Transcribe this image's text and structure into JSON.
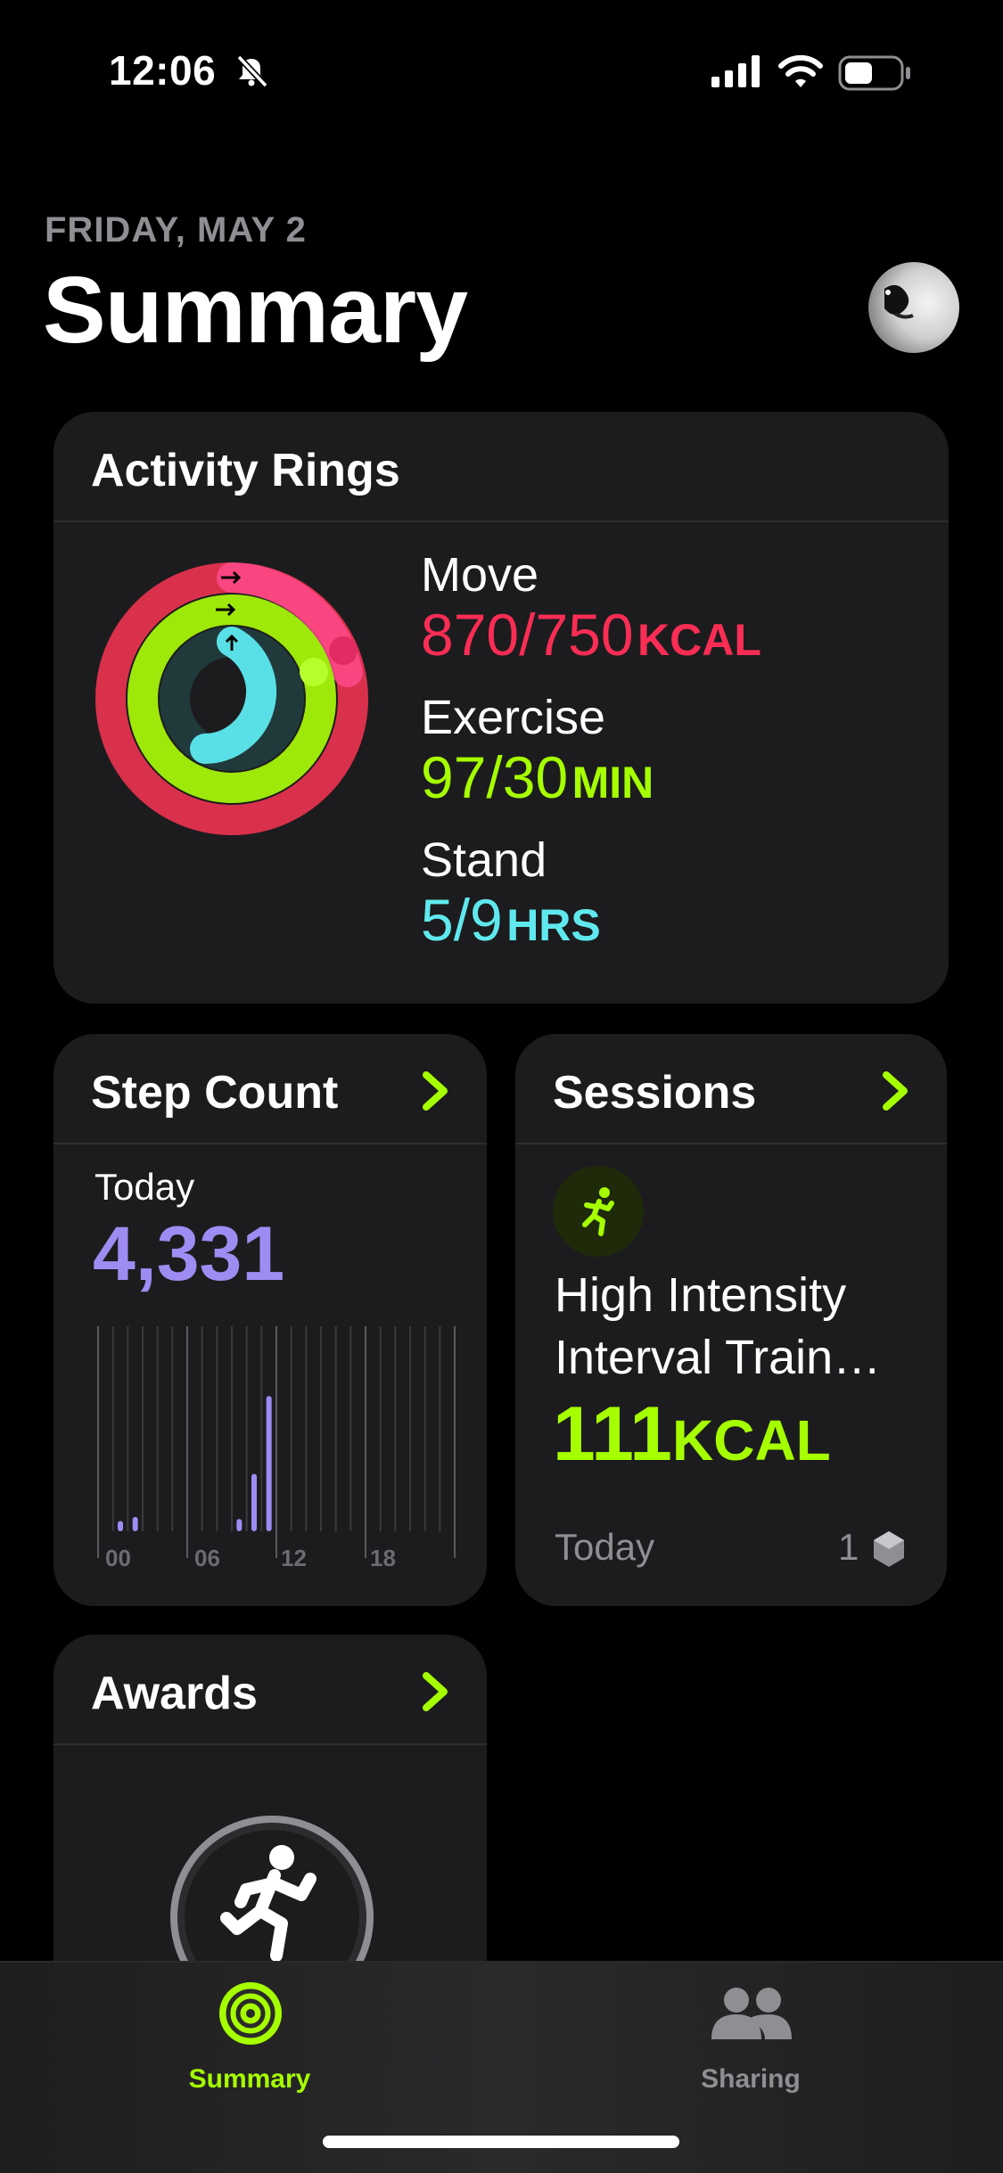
{
  "status_bar": {
    "time": "12:06",
    "silent": true
  },
  "header": {
    "date": "FRIDAY, MAY 2",
    "title": "Summary"
  },
  "activity": {
    "title": "Activity Rings",
    "move": {
      "label": "Move",
      "value": "870/750",
      "unit": "KCAL",
      "progress": 1.16,
      "color": "#fa2d55"
    },
    "exercise": {
      "label": "Exercise",
      "value": "97/30",
      "unit": "MIN",
      "progress": 3.23,
      "color": "#a6ff00"
    },
    "stand": {
      "label": "Stand",
      "value": "5/9",
      "unit": "HRS",
      "progress": 0.56,
      "color": "#5fe9ee"
    }
  },
  "steps": {
    "title": "Step Count",
    "period": "Today",
    "value": "4,331",
    "hour_ticks": [
      "00",
      "06",
      "12",
      "18"
    ],
    "hourly_relative": [
      0,
      0.05,
      0.07,
      0,
      0,
      0,
      0,
      0,
      0,
      0.06,
      0.28,
      0.66,
      0,
      0,
      0,
      0,
      0,
      0,
      0,
      0,
      0,
      0,
      0,
      0
    ],
    "color": "#9f8cf2"
  },
  "sessions": {
    "title": "Sessions",
    "name": "High Intensity Interval Train…",
    "value": "111",
    "unit": "KCAL",
    "period": "Today",
    "count": "1",
    "color": "#a6ff00"
  },
  "awards": {
    "title": "Awards"
  },
  "tabbar": {
    "summary": {
      "label": "Summary",
      "active": true,
      "color": "#a6ff00"
    },
    "sharing": {
      "label": "Sharing",
      "active": false,
      "color": "#8e8e93"
    }
  }
}
